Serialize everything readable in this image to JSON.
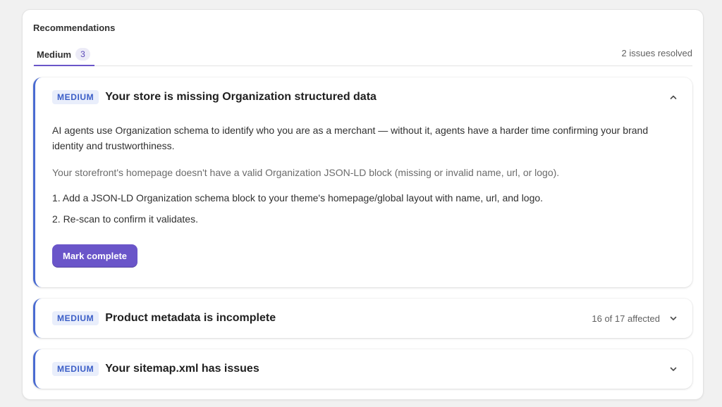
{
  "card": {
    "title": "Recommendations",
    "tab": {
      "label": "Medium",
      "count": "3"
    },
    "resolved": "2 issues resolved"
  },
  "issues": [
    {
      "severity": "MEDIUM",
      "title": "Your store is missing Organization structured data",
      "expanded": true,
      "description": "AI agents use Organization schema to identify who you are as a merchant — without it, agents have a harder time confirming your brand identity and trustworthiness.",
      "detail": "Your storefront's homepage doesn't have a valid Organization JSON-LD block (missing or invalid name, url, or logo).",
      "steps": [
        "1. Add a JSON-LD Organization schema block to your theme's homepage/global layout with name, url, and logo.",
        "2. Re-scan to confirm it validates."
      ],
      "button": "Mark complete",
      "chevron_icon": "chevron-up-icon"
    },
    {
      "severity": "MEDIUM",
      "title": "Product metadata is incomplete",
      "expanded": false,
      "affected": "16 of 17 affected",
      "chevron_icon": "chevron-down-icon"
    },
    {
      "severity": "MEDIUM",
      "title": "Your sitemap.xml has issues",
      "expanded": false,
      "chevron_icon": "chevron-down-icon"
    }
  ],
  "colors": {
    "accent": "#6a55c9",
    "severity_medium": "#3b5ec7",
    "issue_border": "#4a6bd1"
  }
}
